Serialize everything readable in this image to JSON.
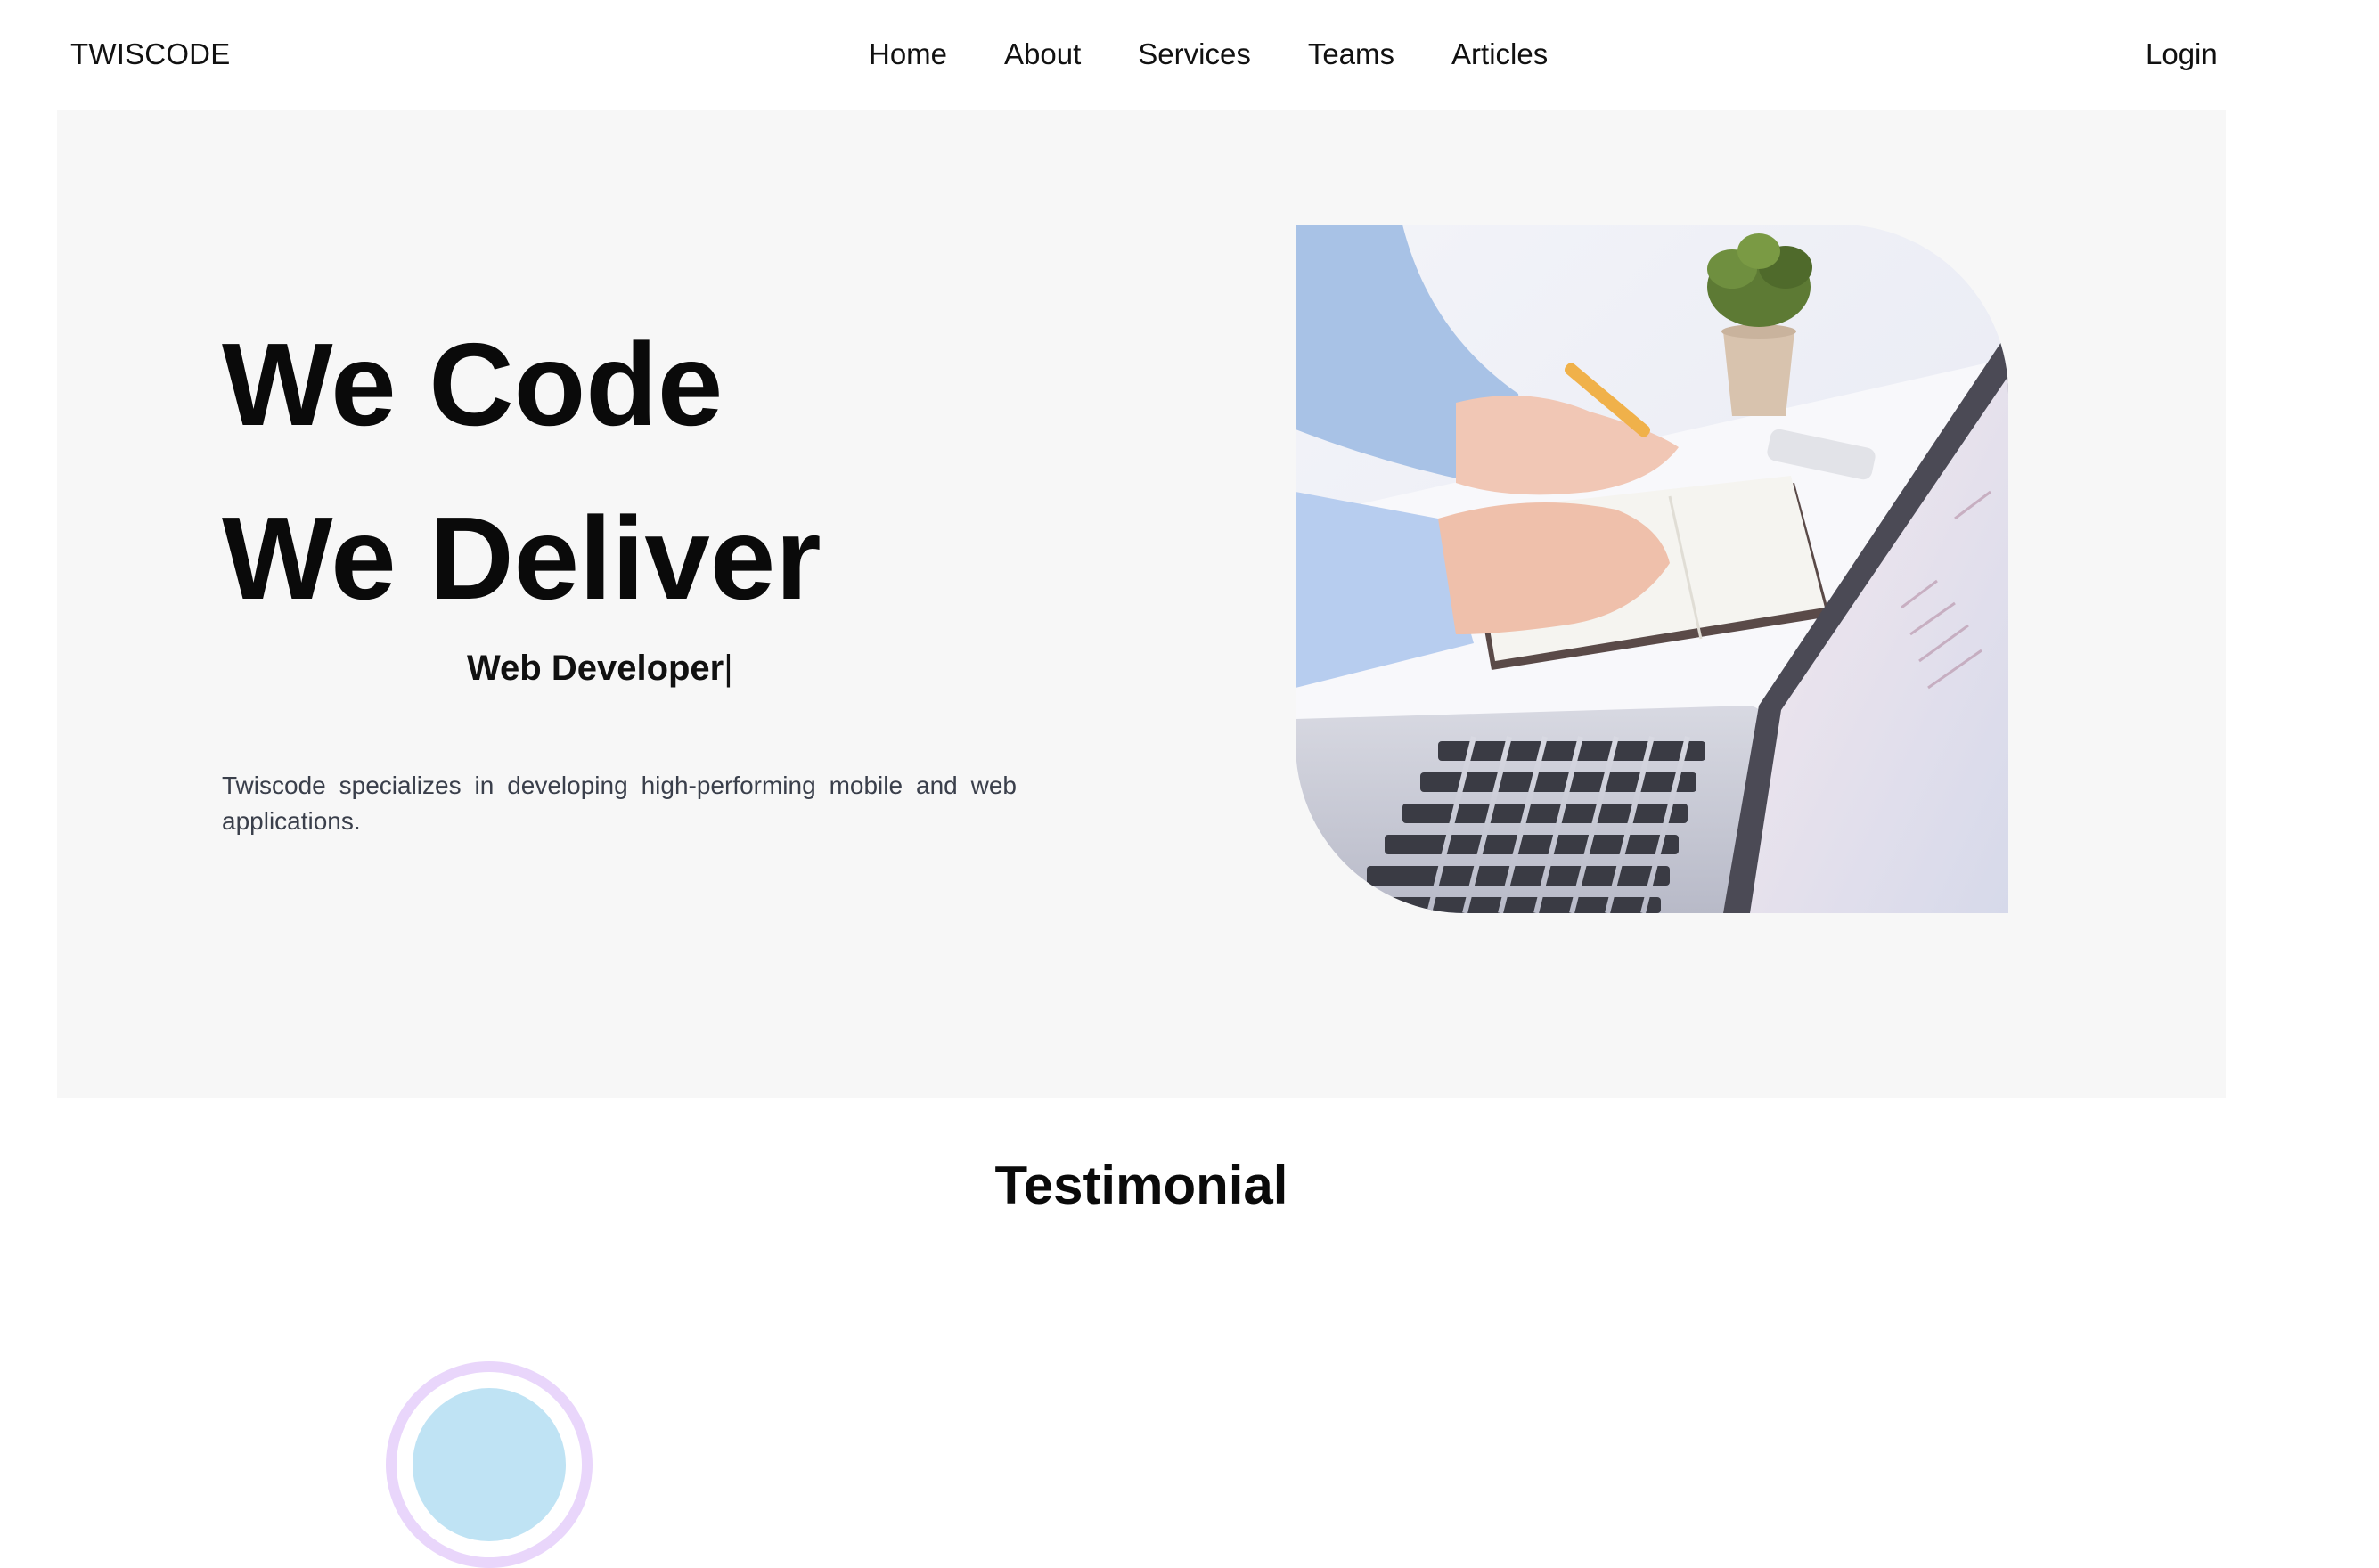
{
  "navbar": {
    "brand": "TWISCODE",
    "links": [
      {
        "label": "Home"
      },
      {
        "label": "About"
      },
      {
        "label": "Services"
      },
      {
        "label": "Teams"
      },
      {
        "label": "Articles"
      }
    ],
    "login": "Login"
  },
  "hero": {
    "line1": "We Code",
    "line2": "We Deliver",
    "typed_text": "Web Developer",
    "cursor": "|",
    "description": "Twiscode specializes in developing high-performing mobile and web applications.",
    "image_icon": "laptop-workspace-photo"
  },
  "testimonial": {
    "title": "Testimonial",
    "avatar_icon": "avatar-icon"
  },
  "colors": {
    "hero_bg": "#f7f7f7",
    "text": "#0a0a0a",
    "desc_text": "#3a3f4b",
    "avatar_ring": "#e9d6fb"
  }
}
